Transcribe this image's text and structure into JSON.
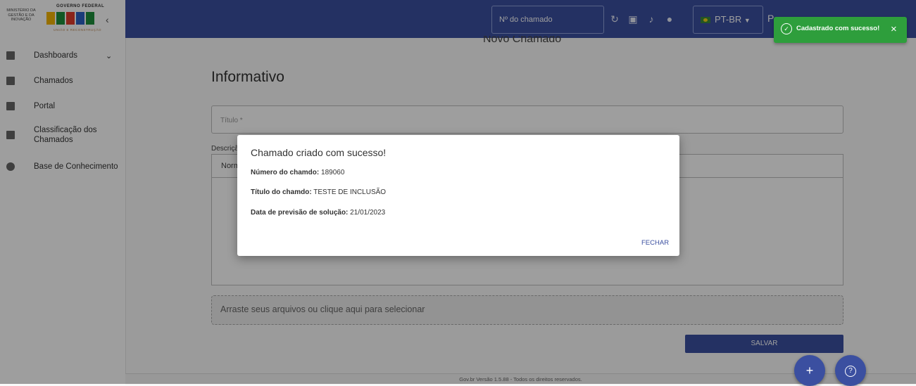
{
  "header": {
    "logo": {
      "ministry": "MINISTÉRIO DA GESTÃO E DA INOVAÇÃO",
      "government": "GOVERNO FEDERAL",
      "brand": "BRASIL",
      "tagline": "UNIÃO E RECONSTRUÇÃO"
    },
    "search_placeholder": "Nº do chamado",
    "language": "PT-BR",
    "user_initial": "P"
  },
  "toast": {
    "message": "Cadastrado com sucesso!",
    "close_label": "×"
  },
  "sidebar": {
    "items": [
      {
        "label": "Dashboards",
        "icon": "dashboard-icon",
        "has_chevron": true
      },
      {
        "label": "Chamados",
        "icon": "ticket-icon"
      },
      {
        "label": "Portal",
        "icon": "portal-icon"
      },
      {
        "label": "Classificação dos Chamados",
        "icon": "book-icon"
      },
      {
        "label": "Base de Conhecimento",
        "icon": "lightbulb-icon"
      }
    ]
  },
  "main": {
    "page_title": "Novo Chamado",
    "section_title": "Informativo",
    "title_field_label": "Título *",
    "description_label": "Descrição",
    "editor_font": "Normal",
    "dropzone_text": "Arraste seus arquivos ou clique aqui para selecionar",
    "save_label": "SALVAR"
  },
  "footer": {
    "text": "Gov.br Versão 1.5.88 - Todos os direitos reservados."
  },
  "dialog": {
    "title": "Chamado criado com sucesso!",
    "number_label": "Número do chamdo:",
    "number_value": "189060",
    "ticket_title_label": "Título do chamdo:",
    "ticket_title_value": "TESTE DE INCLUSÃO",
    "forecast_label": "Data de previsão de solução:",
    "forecast_value": "21/01/2023",
    "close_label": "FECHAR"
  },
  "fabs": {
    "add_label": "+",
    "help_label": "?"
  },
  "colors": {
    "primary": "#3b4fa0",
    "success": "#2e9e3c"
  }
}
